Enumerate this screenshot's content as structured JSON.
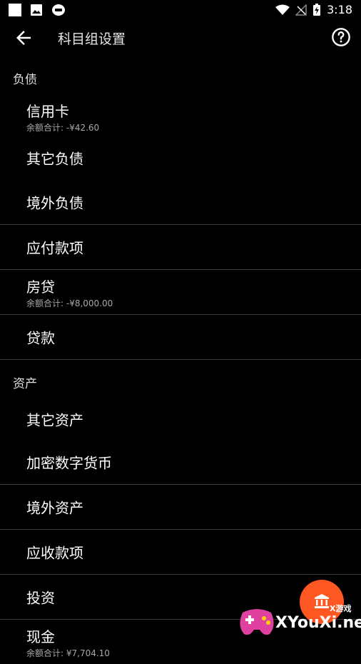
{
  "statusbar": {
    "time": "3:18"
  },
  "appbar": {
    "title": "科目组设置"
  },
  "sections": [
    {
      "header": "负债",
      "items": [
        {
          "label": "信用卡",
          "sub": "余额合计: -¥42.60"
        },
        {
          "label": "其它负债"
        },
        {
          "label": "境外负债"
        },
        {
          "label": "应付款项"
        },
        {
          "label": "房贷",
          "sub": "余额合计: -¥8,000.00"
        },
        {
          "label": "贷款"
        }
      ]
    },
    {
      "header": "资产",
      "items": [
        {
          "label": "其它资产"
        },
        {
          "label": "加密数字货币"
        },
        {
          "label": "境外资产"
        },
        {
          "label": "应收款项"
        },
        {
          "label": "投资"
        },
        {
          "label": "现金",
          "sub": "余额合计: ¥7,704.10"
        }
      ]
    }
  ],
  "watermark": {
    "brand": "XYouXi.net",
    "small": "X游戏"
  },
  "colors": {
    "accent": "#ff5722",
    "divider": "#3a3a3a"
  },
  "icons": {
    "back": "arrow-back-icon",
    "help": "help-circle-icon",
    "fab": "bank-icon"
  }
}
